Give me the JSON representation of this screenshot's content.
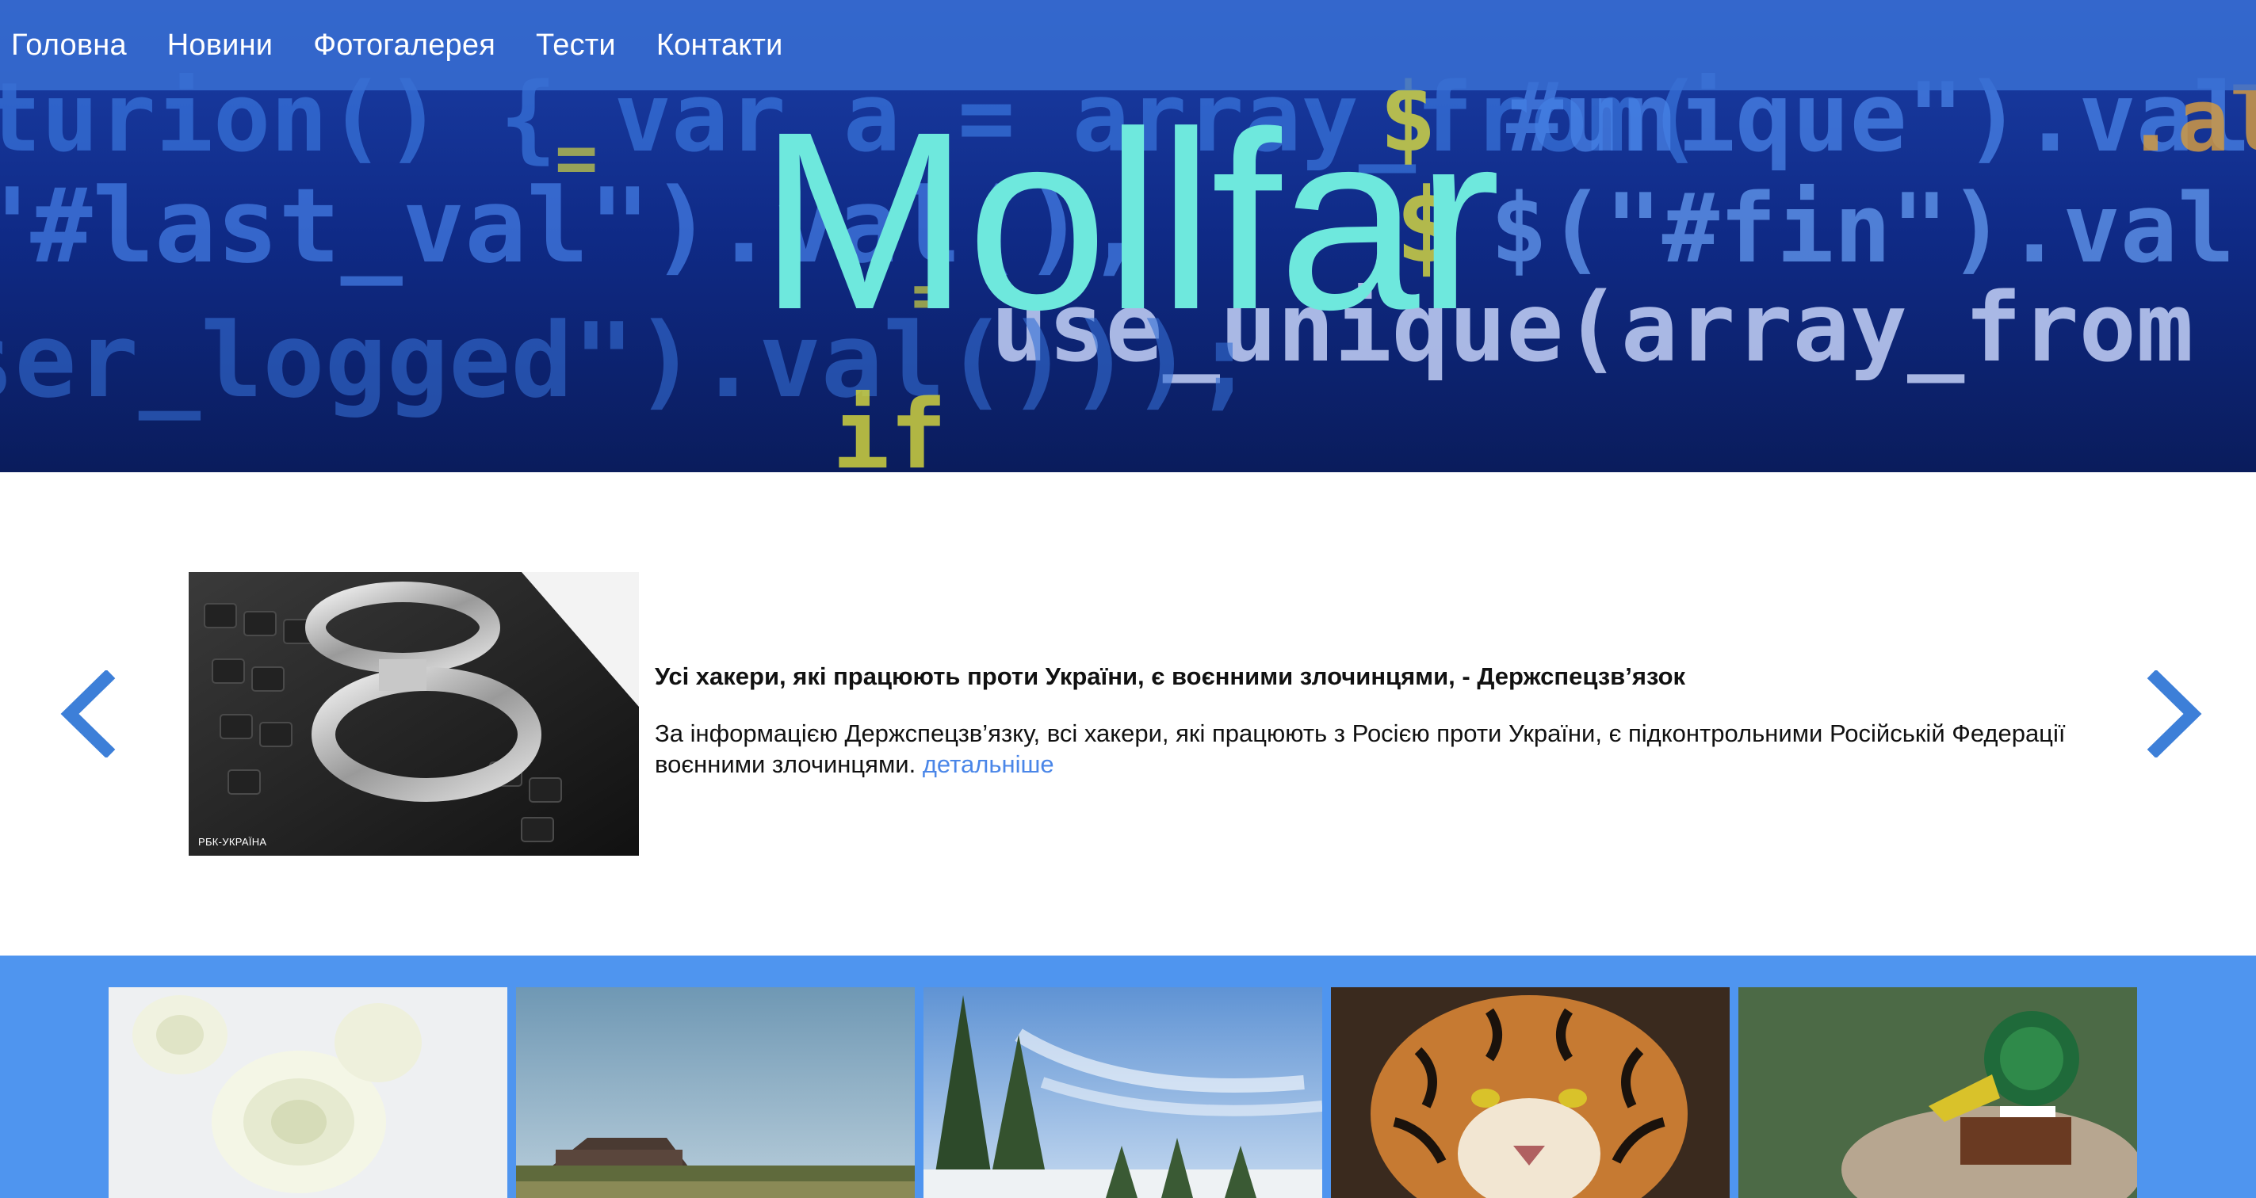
{
  "nav": {
    "items": [
      {
        "label": "Головна"
      },
      {
        "label": "Новини"
      },
      {
        "label": "Фотогалерея"
      },
      {
        "label": "Тести"
      },
      {
        "label": "Контакти"
      }
    ]
  },
  "hero": {
    "title": "Mollfar",
    "background": "code-screen-image"
  },
  "news": {
    "headline": "Усі хакери, які працюють проти України, є воєнними злочинцями, - Держспецзв’язок",
    "body": "За інформацією Держспецзв’язку, всі хакери, які працюють з Росією проти України, є підконтрольними Російській Федерації воєнними злочинцями.",
    "more_label": "детальніше",
    "image_caption": "РБК-УКРАЇНА",
    "image": "handcuffs-on-keyboard-image",
    "prev_icon": "chevron-left-icon",
    "next_icon": "chevron-right-icon"
  },
  "gallery": {
    "items": [
      {
        "image": "white-roses-image"
      },
      {
        "image": "house-field-image"
      },
      {
        "image": "fir-trees-sky-image"
      },
      {
        "image": "tiger-image"
      },
      {
        "image": "duck-image"
      }
    ]
  },
  "colors": {
    "nav_bg": "#386ed2",
    "title": "#6ee8dd",
    "arrow": "#3d7fd8",
    "link": "#4a86e8",
    "gallery_bg": "#4f95ef"
  }
}
